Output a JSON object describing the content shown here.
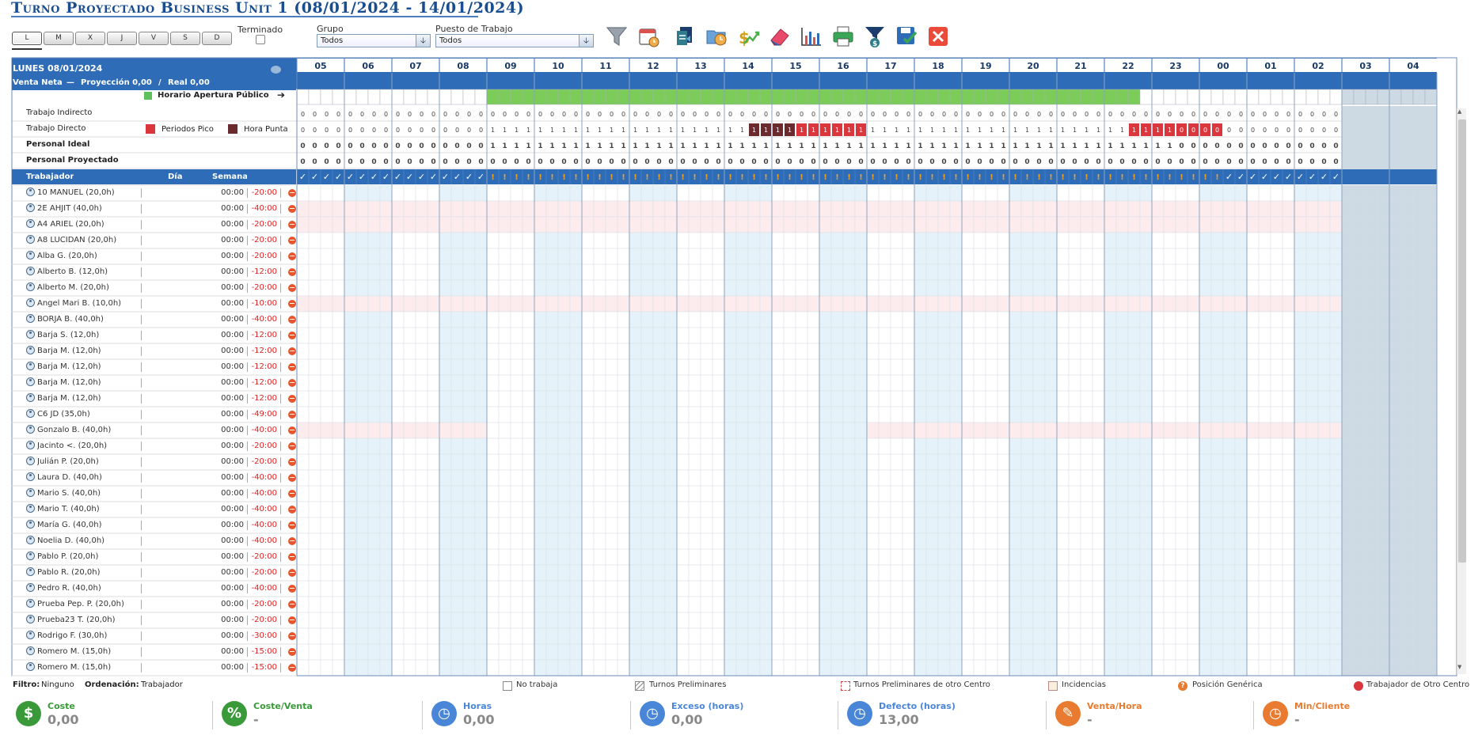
{
  "page": {
    "title": "Turno Proyectado Business Unit 1 (08/01/2024 - 14/01/2024)"
  },
  "toolbar": {
    "days": [
      "L",
      "M",
      "X",
      "J",
      "V",
      "S",
      "D"
    ],
    "selected_day": 0,
    "terminado_label": "Terminado",
    "grupo_label": "Grupo",
    "grupo_value": "Todos",
    "puesto_label": "Puesto de Trabajo",
    "puesto_value": "Todos",
    "tools": [
      "filter-icon",
      "calendar-icon",
      "copy-icon",
      "folder-clock-icon",
      "money-trend-icon",
      "eraser-icon",
      "bar-chart-icon",
      "printer-icon",
      "filter-money-icon",
      "save-icon",
      "close-icon"
    ]
  },
  "header": {
    "date_label": "LUNES 08/01/2024",
    "venta_label": "Venta Neta",
    "dash": "—",
    "proyeccion": "Proyección 0,00",
    "slash": "/",
    "real": "Real 0,00",
    "horario_label": "Horario Apertura Público",
    "trabajo_indirecto": "Trabajo Indirecto",
    "trabajo_directo": "Trabajo Directo",
    "periodos_pico": "Periodos Pico",
    "hora_punta": "Hora Punta",
    "personal_ideal": "Personal Ideal",
    "personal_proyectado": "Personal Proyectado",
    "col_trabajador": "Trabajador",
    "col_dia": "Día",
    "col_semana": "Semana"
  },
  "hours": [
    "05",
    "06",
    "07",
    "08",
    "09",
    "10",
    "11",
    "12",
    "13",
    "14",
    "15",
    "16",
    "17",
    "18",
    "19",
    "20",
    "21",
    "22",
    "23",
    "00",
    "01",
    "02",
    "03",
    "04"
  ],
  "rows": {
    "trabajo_indirecto": "000000000000000000000000000000000000000000000000000000000000000000000000000000000000000000",
    "trabajo_directo": "000000000000000011111111111111111111111111111111111111111111111111111111111111111111111111111100000000000000000000",
    "personal_ideal": "000000000000000011111111111111111111111111111111111111111111111111111111111111111111111111111100000000000000000000",
    "personal_proyectado": "000000000000000000000000000000000000000000000000000000000000000000000000000000000000000000"
  },
  "workers": [
    {
      "name": "10 MANUEL (20,0h)",
      "day": "00:00",
      "delta": "-20:00"
    },
    {
      "name": "2E AHJIT (40,0h)",
      "day": "00:00",
      "delta": "-40:00"
    },
    {
      "name": "A4 ARIEL (20,0h)",
      "day": "00:00",
      "delta": "-20:00"
    },
    {
      "name": "A8 LUCIDAN (20,0h)",
      "day": "00:00",
      "delta": "-20:00"
    },
    {
      "name": "Alba G. (20,0h)",
      "day": "00:00",
      "delta": "-20:00"
    },
    {
      "name": "Alberto B. (12,0h)",
      "day": "00:00",
      "delta": "-12:00"
    },
    {
      "name": "Alberto M. (20,0h)",
      "day": "00:00",
      "delta": "-20:00"
    },
    {
      "name": "Angel Mari B. (10,0h)",
      "day": "00:00",
      "delta": "-10:00"
    },
    {
      "name": "BORJA B. (40,0h)",
      "day": "00:00",
      "delta": "-40:00"
    },
    {
      "name": "Barja S. (12,0h)",
      "day": "00:00",
      "delta": "-12:00"
    },
    {
      "name": "Barja M. (12,0h)",
      "day": "00:00",
      "delta": "-12:00"
    },
    {
      "name": "Barja M. (12,0h)",
      "day": "00:00",
      "delta": "-12:00"
    },
    {
      "name": "Barja M. (12,0h)",
      "day": "00:00",
      "delta": "-12:00"
    },
    {
      "name": "Barja M. (12,0h)",
      "day": "00:00",
      "delta": "-12:00"
    },
    {
      "name": "C6 JD (35,0h)",
      "day": "00:00",
      "delta": "-49:00"
    },
    {
      "name": "Gonzalo B. (40,0h)",
      "day": "00:00",
      "delta": "-40:00"
    },
    {
      "name": "Jacinto <. (20,0h)",
      "day": "00:00",
      "delta": "-20:00"
    },
    {
      "name": "Julián P. (20,0h)",
      "day": "00:00",
      "delta": "-20:00"
    },
    {
      "name": "Laura D. (40,0h)",
      "day": "00:00",
      "delta": "-40:00"
    },
    {
      "name": "Mario S. (40,0h)",
      "day": "00:00",
      "delta": "-40:00"
    },
    {
      "name": "Mario T. (40,0h)",
      "day": "00:00",
      "delta": "-40:00"
    },
    {
      "name": "María G. (40,0h)",
      "day": "00:00",
      "delta": "-40:00"
    },
    {
      "name": "Noelia D. (40,0h)",
      "day": "00:00",
      "delta": "-40:00"
    },
    {
      "name": "Pablo P. (20,0h)",
      "day": "00:00",
      "delta": "-20:00"
    },
    {
      "name": "Pablo R. (20,0h)",
      "day": "00:00",
      "delta": "-20:00"
    },
    {
      "name": "Pedro R. (40,0h)",
      "day": "00:00",
      "delta": "-40:00"
    },
    {
      "name": "Prueba Pep. P. (20,0h)",
      "day": "00:00",
      "delta": "-20:00"
    },
    {
      "name": "Prueba23 T. (20,0h)",
      "day": "00:00",
      "delta": "-20:00"
    },
    {
      "name": "Rodrigo F. (30,0h)",
      "day": "00:00",
      "delta": "-30:00"
    },
    {
      "name": "Romero M. (15,0h)",
      "day": "00:00",
      "delta": "-15:00"
    },
    {
      "name": "Romero M. (15,0h)",
      "day": "00:00",
      "delta": "-15:00"
    }
  ],
  "footer": {
    "filtro_label": "Filtro:",
    "filtro_value": "Ninguno",
    "orden_label": "Ordenación:",
    "orden_value": "Trabajador",
    "legend": [
      "No trabaja",
      "Turnos Preliminares",
      "Turnos Preliminares de otro Centro",
      "Incidencias",
      "Posición Genérica",
      "Trabajador de Otro Centro"
    ]
  },
  "kpis": [
    {
      "label": "Coste",
      "value": "0,00",
      "icon": "dollar-icon",
      "color": "#3a9a3a"
    },
    {
      "label": "Coste/Venta",
      "value": "-",
      "icon": "percent-icon",
      "color": "#3a9a3a"
    },
    {
      "label": "Horas",
      "value": "0,00",
      "icon": "clock-icon",
      "color": "#4a86d8"
    },
    {
      "label": "Exceso (horas)",
      "value": "0,00",
      "icon": "clock-plus-icon",
      "color": "#4a86d8"
    },
    {
      "label": "Defecto (horas)",
      "value": "13,00",
      "icon": "clock-minus-icon",
      "color": "#4a86d8"
    },
    {
      "label": "Venta/Hora",
      "value": "-",
      "icon": "wrench-money-icon",
      "color": "#e87b30"
    },
    {
      "label": "Min/Cliente",
      "value": "-",
      "icon": "clock-client-icon",
      "color": "#e87b30"
    }
  ]
}
